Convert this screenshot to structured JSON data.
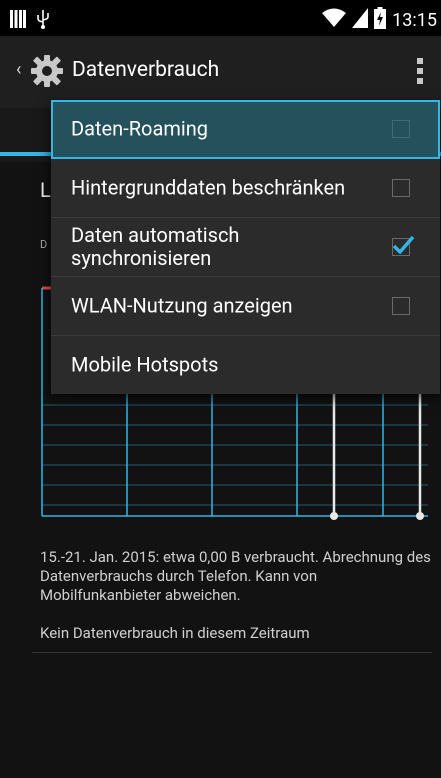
{
  "status_bar": {
    "time": "13:15",
    "icons": [
      "storage-icon",
      "usb-icon",
      "wifi-icon",
      "signal-icon",
      "battery-icon"
    ]
  },
  "action_bar": {
    "title": "Datenverbrauch",
    "app_icon": "gear-icon",
    "overflow_icon": "overflow-menu-icon"
  },
  "background": {
    "heading_partial": "L",
    "sub_partial": "D"
  },
  "menu": {
    "items": [
      {
        "label": "Daten-Roaming",
        "checkbox": true,
        "checked": false,
        "highlighted": true
      },
      {
        "label": "Hintergrunddaten beschränken",
        "checkbox": true,
        "checked": false
      },
      {
        "label": "Daten automatisch synchronisieren",
        "checkbox": true,
        "checked": true
      },
      {
        "label": "WLAN-Nutzung anzeigen",
        "checkbox": true,
        "checked": false
      },
      {
        "label": "Mobile Hotspots",
        "checkbox": false
      }
    ]
  },
  "usage": {
    "summary": "15.-21. Jan. 2015: etwa 0,00 B verbraucht. Abrechnung des Datenverbrauchs durch Telefon. Kann von Mobilfunkanbieter abweichen.",
    "none": "Kein Datenverbrauch in diesem Zeitraum"
  },
  "colors": {
    "accent": "#33b5e5",
    "warning_line": "#e24b4b",
    "menu_bg": "#2b2b2b",
    "menu_highlight": "#24515c"
  }
}
